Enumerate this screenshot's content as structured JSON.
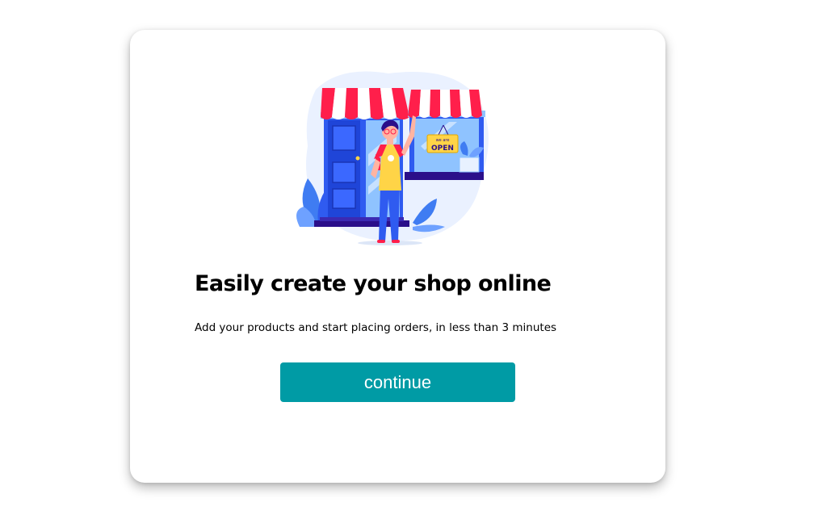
{
  "onboarding": {
    "headline": "Easily create your shop online",
    "subtitle": "Add your products and start placing orders, in less than 3 minutes",
    "continue_label": "continue",
    "illustration": {
      "sign_small_text": "we are",
      "sign_text": "OPEN"
    }
  },
  "colors": {
    "accent": "#009ba5",
    "awning_red": "#ff1f4b",
    "shop_blue": "#2f5bf0",
    "shop_navy": "#2b0f8a"
  }
}
